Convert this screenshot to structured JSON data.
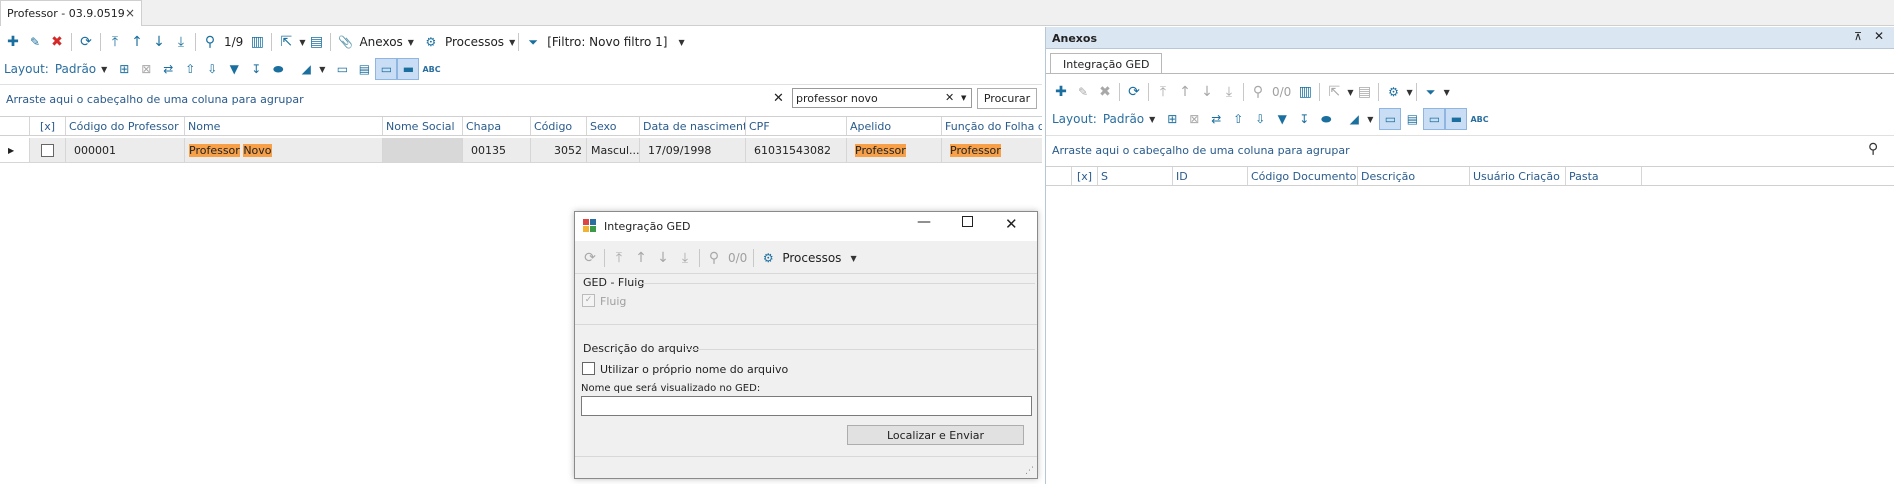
{
  "document_tab": {
    "title": "Professor - 03.9.0519",
    "close": "×"
  },
  "main_toolbar": {
    "record_pos": "1/9",
    "anexos": "Anexos",
    "processos": "Processos",
    "filter": "[Filtro: Novo filtro 1]"
  },
  "layout_bar": {
    "label": "Layout:",
    "value": "Padrão"
  },
  "group_bar": {
    "text": "Arraste aqui o cabeçalho de uma coluna para agrupar",
    "search_value": "professor novo",
    "search_button": "Procurar"
  },
  "grid": {
    "columns": [
      "[x]",
      "Código do Professor",
      "Nome",
      "Nome Social",
      "Chapa",
      "Código",
      "Sexo",
      "Data de nascimento",
      "CPF",
      "Apelido",
      "Função do Folha de"
    ],
    "row": {
      "codigo_professor": "000001",
      "nome_part1": "Professor",
      "nome_part2": "Novo",
      "nome_social": "",
      "chapa": "00135",
      "codigo": "3052",
      "sexo": "Mascul...",
      "data_nascimento": "17/09/1998",
      "cpf": "61031543082",
      "apelido": "Professor",
      "funcao": "Professor"
    }
  },
  "anexos_panel": {
    "title": "Anexos",
    "tab": "Integração GED",
    "record_pos": "0/0",
    "layout_label": "Layout:",
    "layout_value": "Padrão",
    "group_text": "Arraste aqui o cabeçalho de uma coluna para agrupar",
    "columns": [
      "[x]",
      "S",
      "ID",
      "Código Documento",
      "Descrição",
      "Usuário Criação",
      "Pasta"
    ]
  },
  "dialog": {
    "title": "Integração GED",
    "record_pos": "0/0",
    "processos": "Processos",
    "group_ged": "GED - Fluig",
    "fluig_checkbox": "Fluig",
    "group_desc": "Descrição do arquivo",
    "use_filename_checkbox": "Utilizar o próprio nome do arquivo",
    "name_label": "Nome que será visualizado no GED:",
    "name_value": "",
    "send_button": "Localizar e Enviar"
  },
  "colors": {
    "accent": "#1a6f9e",
    "highlight": "#f7a048",
    "delete": "#d42a2a",
    "panel_header": "#dbe6f3"
  }
}
